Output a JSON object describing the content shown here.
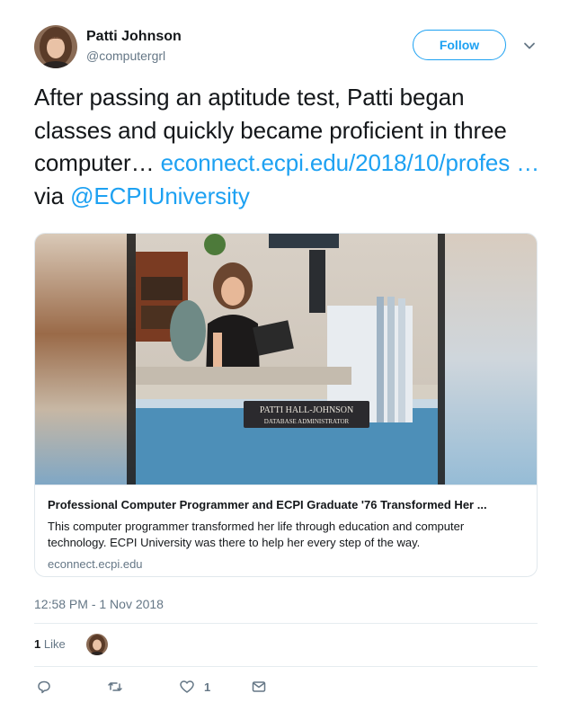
{
  "author": {
    "name": "Patti Johnson",
    "handle": "@computergrl"
  },
  "follow_label": "Follow",
  "tweet": {
    "text": "After passing an aptitude test, Patti began classes and quickly became proficient in three computer…",
    "link_text": "econnect.ecpi.edu/2018/10/profes …",
    "via_text": "via",
    "mention": "@ECPIUniversity"
  },
  "card": {
    "image_nameplate_line1": "PATTI HALL-JOHNSON",
    "image_nameplate_line2": "DATABASE ADMINISTRATOR",
    "title": "Professional Computer Programmer and ECPI Graduate '76 Transformed Her ...",
    "description": "This computer programmer transformed her life through education and computer technology. ECPI University was there to help her every step of the way.",
    "domain": "econnect.ecpi.edu"
  },
  "timestamp": "12:58 PM - 1 Nov 2018",
  "likes": {
    "count": "1",
    "label": "Like"
  },
  "actions": {
    "like_count": "1"
  },
  "colors": {
    "accent": "#1da1f2",
    "secondary_text": "#657786",
    "border": "#e1e8ed"
  }
}
